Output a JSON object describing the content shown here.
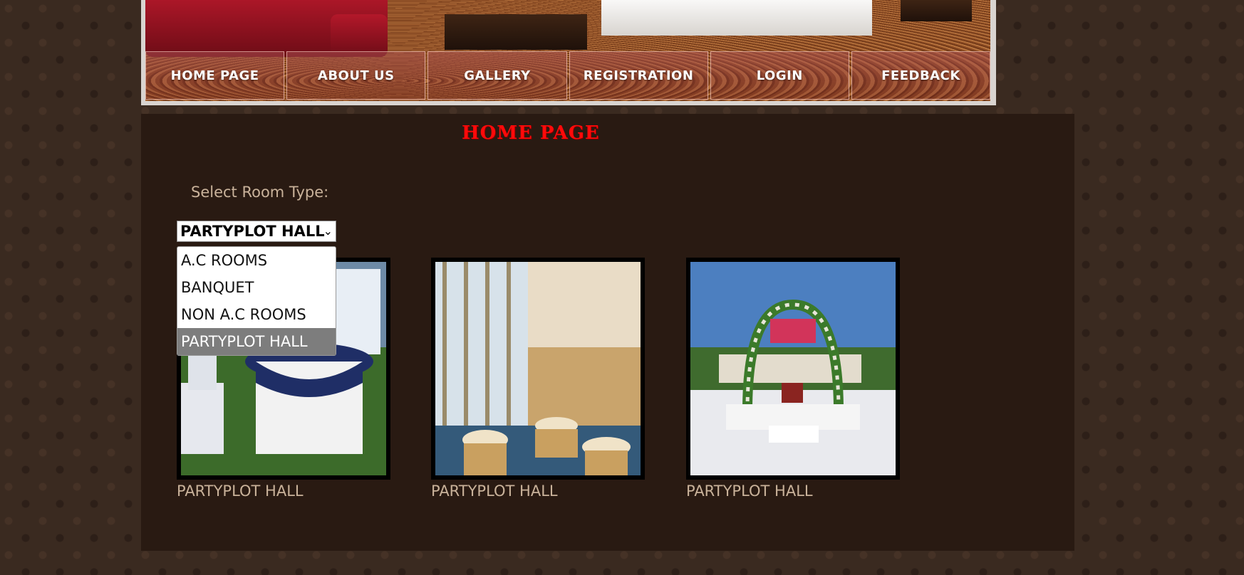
{
  "nav": {
    "items": [
      {
        "label": "HOME PAGE"
      },
      {
        "label": "ABOUT US"
      },
      {
        "label": "GALLERY"
      },
      {
        "label": "REGISTRATION"
      },
      {
        "label": "LOGIN"
      },
      {
        "label": "FEEDBACK"
      }
    ]
  },
  "page": {
    "title": "HOME PAGE",
    "room_type_label": "Select Room Type:"
  },
  "room_select": {
    "selected": "PARTYPLOT HALL",
    "options": [
      "A.C ROOMS",
      "BANQUET",
      "NON A.C ROOMS",
      "PARTYPLOT HALL"
    ]
  },
  "gallery": {
    "items": [
      {
        "caption": "PARTYPLOT HALL",
        "image": "garden-tables-photo"
      },
      {
        "caption": "PARTYPLOT HALL",
        "image": "banquet-hall-photo"
      },
      {
        "caption": "PARTYPLOT HALL",
        "image": "wedding-mandap-photo"
      }
    ]
  },
  "colors": {
    "page_background": "#3a2a20",
    "content_background": "#291a12",
    "title": "#ff0a0a",
    "caption": "#c9b29a",
    "selected_option": "#7d7d7d"
  }
}
